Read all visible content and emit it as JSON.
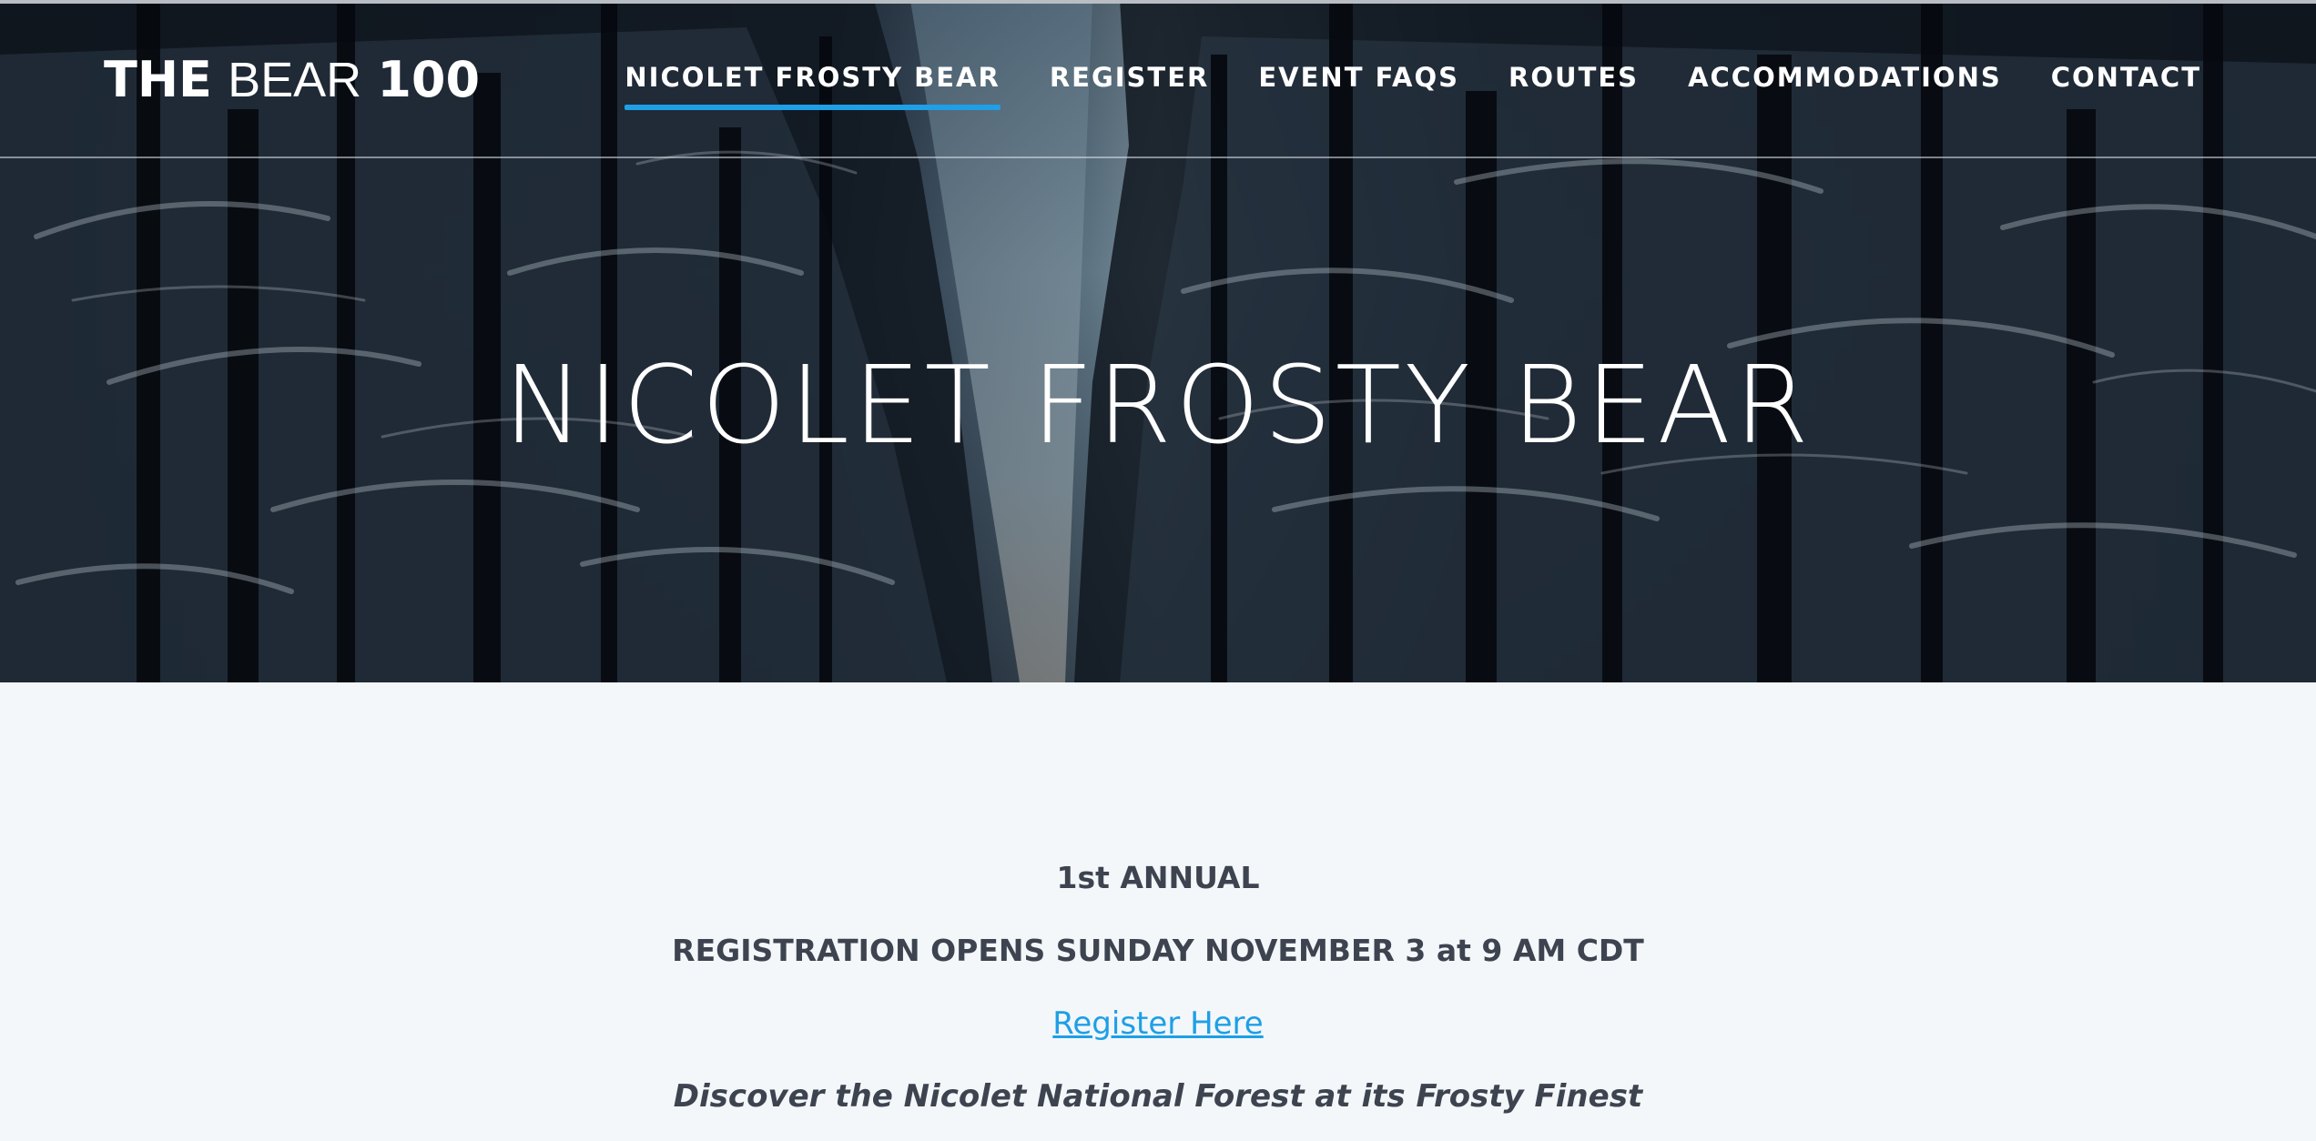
{
  "brand": {
    "logo_part1": "THE",
    "logo_part2": "BEAR",
    "logo_part3": "100"
  },
  "nav": {
    "items": [
      {
        "label": "NICOLET FROSTY BEAR",
        "active": true
      },
      {
        "label": "REGISTER",
        "active": false
      },
      {
        "label": "EVENT FAQS",
        "active": false
      },
      {
        "label": "ROUTES",
        "active": false
      },
      {
        "label": "ACCOMMODATIONS",
        "active": false
      },
      {
        "label": "CONTACT",
        "active": false
      }
    ]
  },
  "hero": {
    "title": "NICOLET FROSTY BEAR",
    "background": "snowy-forest-photo"
  },
  "content": {
    "annual": "1st ANNUAL",
    "registration_opens": "REGISTRATION OPENS SUNDAY NOVEMBER 3 at 9 AM CDT",
    "register_link": "Register Here",
    "tagline": "Discover the Nicolet National Forest at its Frosty Finest"
  },
  "colors": {
    "accent": "#1e9fe6",
    "text_dark": "#3d4450",
    "page_bg": "#f3f7fa"
  }
}
